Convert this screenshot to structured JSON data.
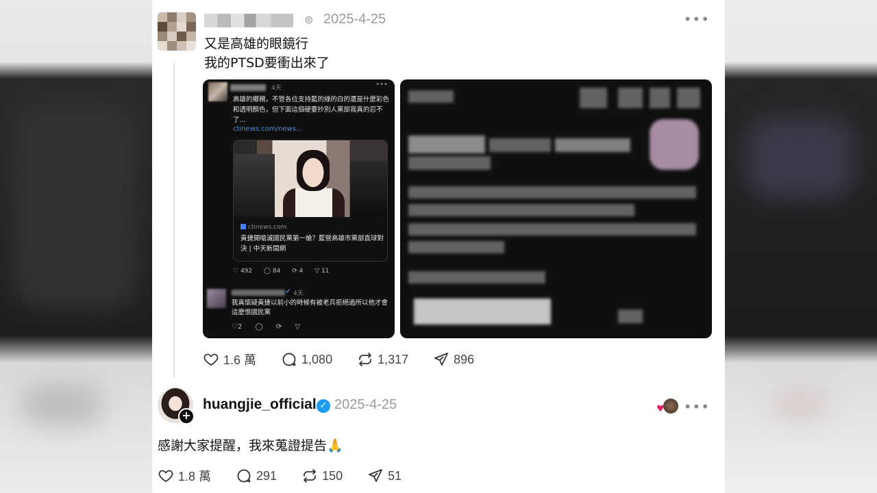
{
  "post1": {
    "date": "2025-4-25",
    "lines": [
      "又是高雄的眼鏡行",
      "我的PTSD要衝出來了"
    ],
    "stats": {
      "likes": "1.6 萬",
      "replies": "1,080",
      "reposts": "1,317",
      "shares": "896"
    },
    "embedded_screenshot": {
      "time": "4天",
      "text": "高雄的鄉親，不管各位支持藍的綠的白的還是什麼彩色和透明顏色，但下面這個硬要抄別人黨部我真的忍不了...",
      "link": "ctinews.com/news...",
      "card_source": "ctinews.com",
      "card_title": "黃捷開嗆滅國民黨第一槍？藍營高雄市黨部直球對決 | 中天新聞網",
      "stats": {
        "likes": "492",
        "replies": "84",
        "reposts": "4",
        "shares": "11"
      },
      "reply_time": "4天",
      "reply_text": "我真懷疑黃捷以前小的時候有被老兵拒絕過所以他才會這麼恨國民黨",
      "reply_stats": {
        "likes": "2"
      }
    }
  },
  "post2": {
    "username": "huangjie_official",
    "date": "2025-4-25",
    "text": "感謝大家提醒，我來蒐證提告🙏",
    "stats": {
      "likes": "1.8 萬",
      "replies": "291",
      "reposts": "150",
      "shares": "51"
    }
  },
  "icons": {
    "heart": "heart-icon",
    "reply": "comment-icon",
    "repost": "repost-icon",
    "share": "send-icon",
    "more": "more-icon"
  },
  "colors": {
    "verified": "#1d9bf0",
    "link": "#4e8bdb",
    "muted": "#9a9a9a"
  }
}
